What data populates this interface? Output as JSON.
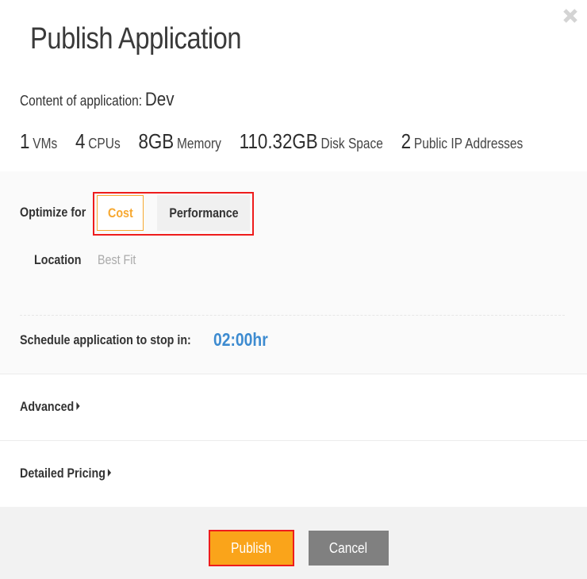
{
  "dialog": {
    "title": "Publish Application",
    "close_icon": "close-icon"
  },
  "content": {
    "label": "Content of application:",
    "value": "Dev"
  },
  "stats": [
    {
      "value": "1",
      "unit": "VMs"
    },
    {
      "value": "4",
      "unit": "CPUs"
    },
    {
      "value": "8GB",
      "unit": "Memory"
    },
    {
      "value": "110.32GB",
      "unit": "Disk Space"
    },
    {
      "value": "2",
      "unit": "Public IP Addresses"
    }
  ],
  "optimize": {
    "label": "Optimize for",
    "options": [
      "Cost",
      "Performance"
    ],
    "selected": "Cost"
  },
  "location": {
    "label": "Location",
    "value": "Best Fit"
  },
  "schedule": {
    "label": "Schedule application to stop in:",
    "value": "02:00hr"
  },
  "sections": {
    "advanced": "Advanced",
    "detailed_pricing": "Detailed Pricing"
  },
  "footer": {
    "publish_label": "Publish",
    "cancel_label": "Cancel"
  },
  "colors": {
    "accent_orange": "#faa41a",
    "selected_text": "#f7a830",
    "link_blue": "#3d8bd0",
    "highlight_red": "#ee1c1c",
    "cancel_gray": "#808080"
  }
}
